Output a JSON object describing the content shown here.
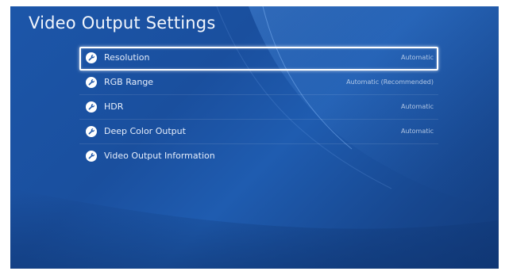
{
  "page": {
    "title": "Video Output Settings"
  },
  "menu": {
    "items": [
      {
        "label": "Resolution",
        "value": "Automatic",
        "icon": "wrench-icon"
      },
      {
        "label": "RGB Range",
        "value": "Automatic (Recommended)",
        "icon": "wrench-icon"
      },
      {
        "label": "HDR",
        "value": "Automatic",
        "icon": "wrench-icon"
      },
      {
        "label": "Deep Color Output",
        "value": "Automatic",
        "icon": "wrench-icon"
      },
      {
        "label": "Video Output Information",
        "value": "",
        "icon": "wrench-icon"
      }
    ],
    "selected_index": 0
  },
  "colors": {
    "background": "#1c56a9",
    "highlight": "#ffffff",
    "text": "#e6eefb"
  }
}
